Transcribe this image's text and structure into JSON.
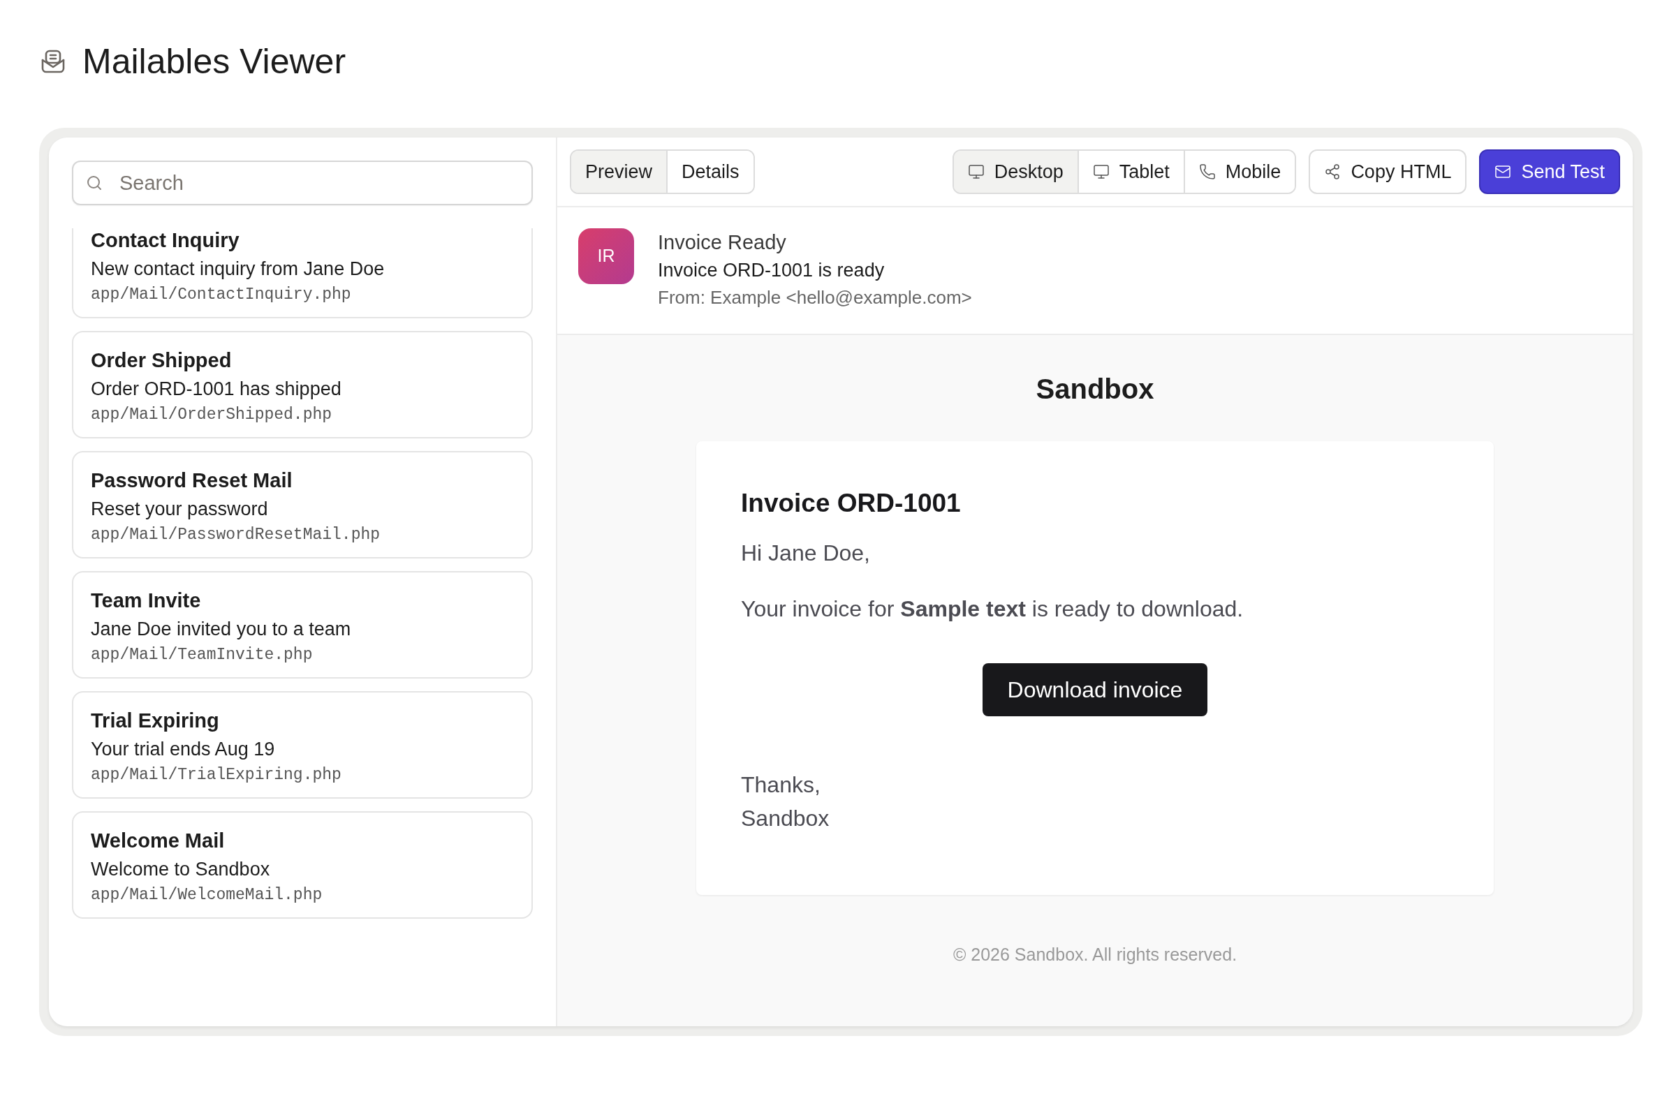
{
  "page": {
    "title": "Mailables Viewer"
  },
  "sidebar": {
    "search": {
      "placeholder": "Search"
    },
    "items": [
      {
        "name": "Contact Inquiry",
        "subject": "New contact inquiry from Jane Doe",
        "path": "app/Mail/ContactInquiry.php",
        "selected": false
      },
      {
        "name": "Order Shipped",
        "subject": "Order ORD-1001 has shipped",
        "path": "app/Mail/OrderShipped.php",
        "selected": false
      },
      {
        "name": "Password Reset Mail",
        "subject": "Reset your password",
        "path": "app/Mail/PasswordResetMail.php",
        "selected": false
      },
      {
        "name": "Team Invite",
        "subject": "Jane Doe invited you to a team",
        "path": "app/Mail/TeamInvite.php",
        "selected": false
      },
      {
        "name": "Trial Expiring",
        "subject": "Your trial ends Aug 19",
        "path": "app/Mail/TrialExpiring.php",
        "selected": false
      },
      {
        "name": "Welcome Mail",
        "subject": "Welcome to Sandbox",
        "path": "app/Mail/WelcomeMail.php",
        "selected": false
      }
    ]
  },
  "toolbar": {
    "tabs": [
      {
        "label": "Preview",
        "selected": true
      },
      {
        "label": "Details",
        "selected": false
      }
    ],
    "viewports": [
      {
        "kind": "desktop",
        "label": "Desktop",
        "selected": true
      },
      {
        "kind": "tablet",
        "label": "Tablet",
        "selected": false
      },
      {
        "kind": "mobile",
        "label": "Mobile",
        "selected": false
      }
    ],
    "copy_button": "Copy HTML",
    "send_button": "Send Test"
  },
  "mail_header": {
    "initials": "IR",
    "name": "Invoice Ready",
    "subject": "Invoice ORD-1001 is ready",
    "from": "From: Example <hello@example.com>"
  },
  "preview": {
    "brand": "Sandbox",
    "heading": "Invoice ORD-1001",
    "greeting": "Hi Jane Doe,",
    "body": "Your invoice for **Sample text** is ready to download.",
    "button": "Download invoice",
    "closing": [
      "Thanks,",
      "Sandbox"
    ],
    "footer": "© 2026 Sandbox. All rights reserved."
  }
}
